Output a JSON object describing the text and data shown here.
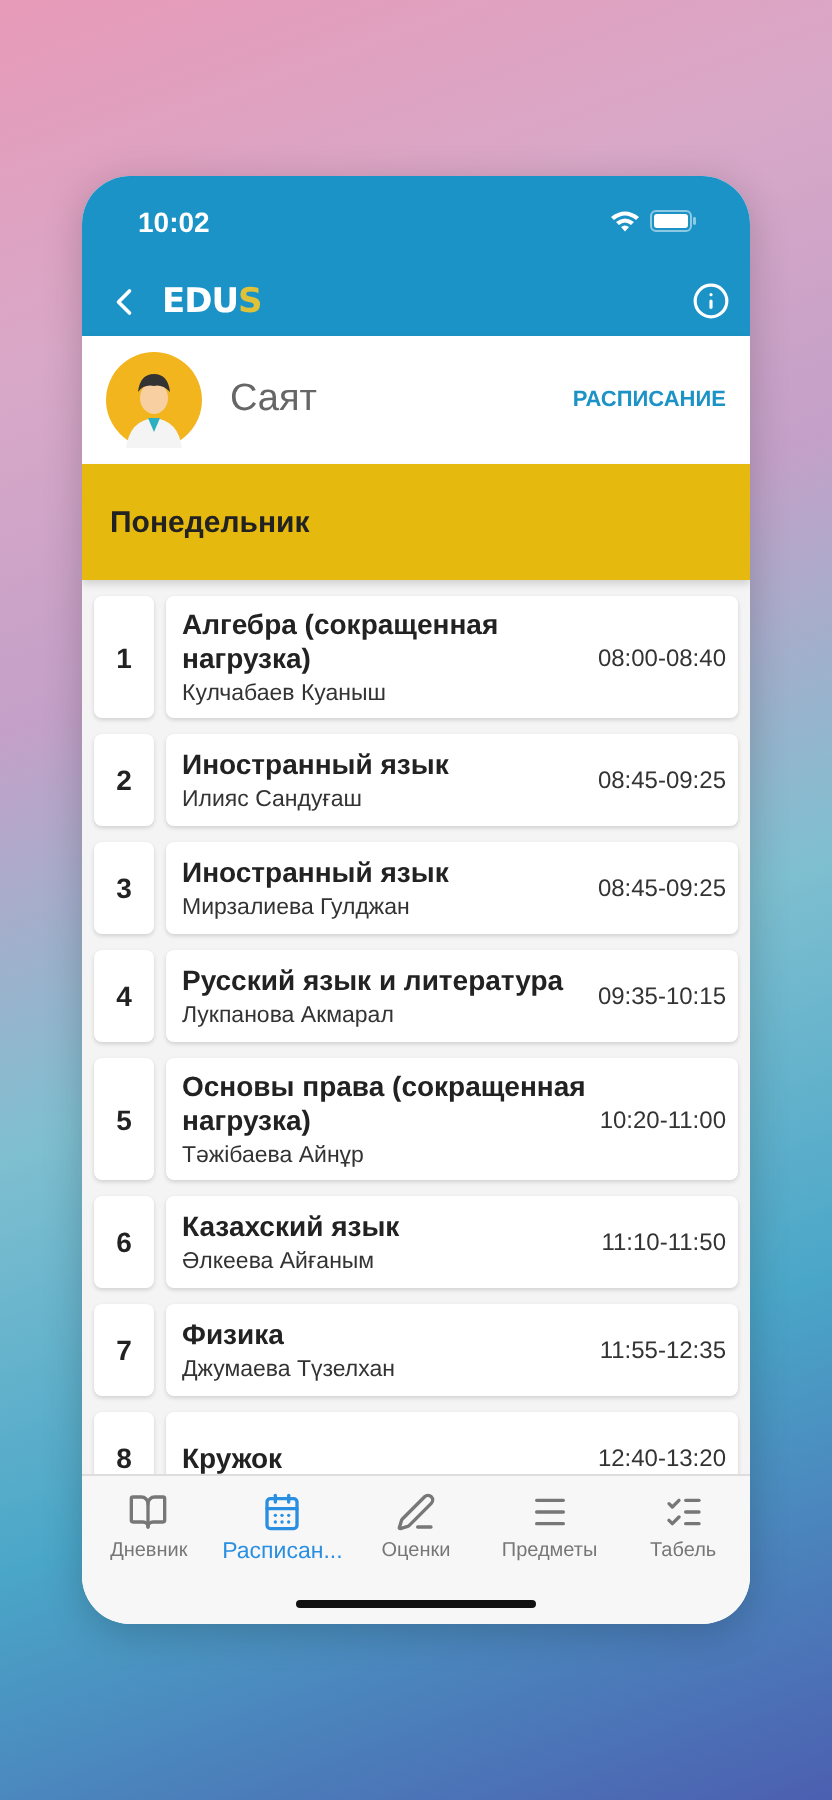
{
  "status_bar": {
    "time": "10:02"
  },
  "nav": {
    "logo": {
      "main": "EDU",
      "accent": "S"
    }
  },
  "profile": {
    "name": "Саят",
    "action": "РАСПИСАНИЕ"
  },
  "day": "Понедельник",
  "lessons": [
    {
      "number": "1",
      "subject": "Алгебра (сокращенная нагрузка)",
      "teacher": "Кулчабаев Куаныш",
      "time": "08:00-08:40"
    },
    {
      "number": "2",
      "subject": "Иностранный язык",
      "teacher": "Илияс Сандуғаш",
      "time": "08:45-09:25"
    },
    {
      "number": "3",
      "subject": "Иностранный язык",
      "teacher": "Мирзалиева Гулджан",
      "time": "08:45-09:25"
    },
    {
      "number": "4",
      "subject": "Русский язык и литература",
      "teacher": "Лукпанова Акмарал",
      "time": "09:35-10:15"
    },
    {
      "number": "5",
      "subject": "Основы права (сокращенная нагрузка)",
      "teacher": "Тәжібаева Айнұр",
      "time": "10:20-11:00"
    },
    {
      "number": "6",
      "subject": "Казахский язык",
      "teacher": "Әлкеева Айғаным",
      "time": "11:10-11:50"
    },
    {
      "number": "7",
      "subject": "Физика",
      "teacher": "Джумаева Түзелхан",
      "time": "11:55-12:35"
    },
    {
      "number": "8",
      "subject": "Кружок",
      "time": "12:40-13:20"
    }
  ],
  "tabs": [
    {
      "kind": "diary",
      "label": "Дневник",
      "selected": false
    },
    {
      "kind": "schedule",
      "label": "Расписан...",
      "selected": true
    },
    {
      "kind": "grades",
      "label": "Оценки",
      "selected": false
    },
    {
      "kind": "subjects",
      "label": "Предметы",
      "selected": false
    },
    {
      "kind": "report",
      "label": "Табель",
      "selected": false
    }
  ]
}
